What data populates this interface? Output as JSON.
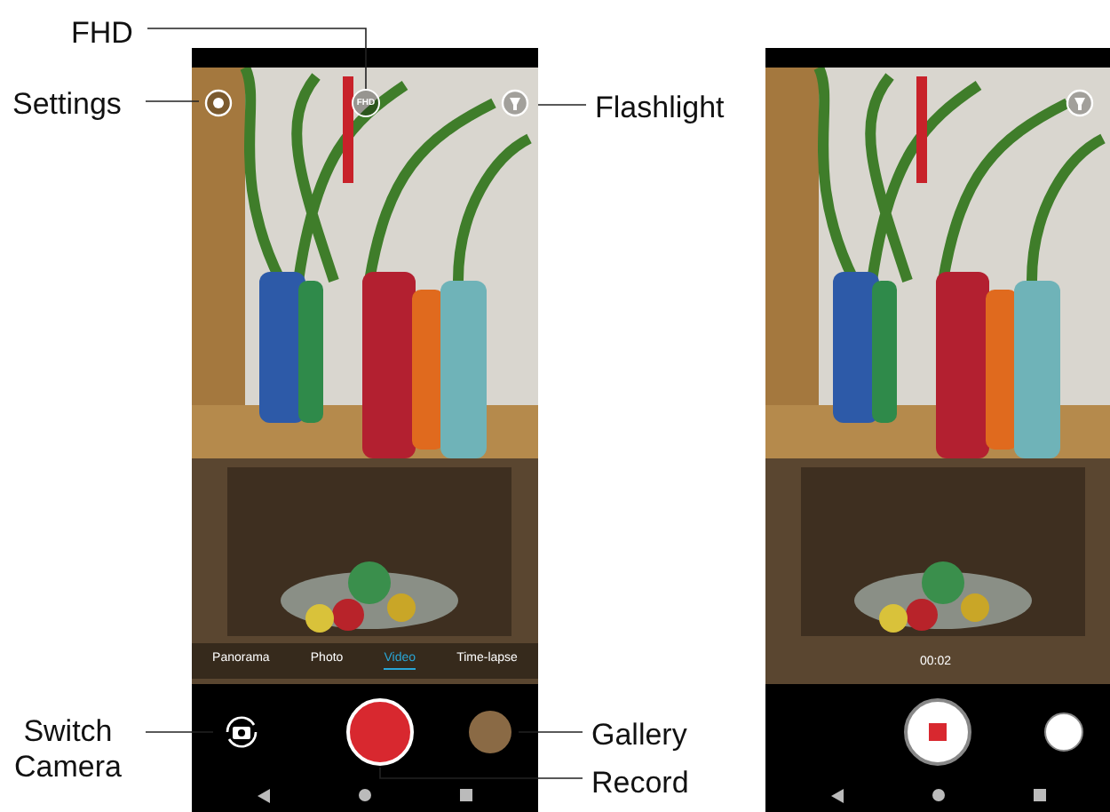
{
  "callouts": [
    "FHD",
    "Settings",
    "Flashlight",
    "Switch\nCamera",
    "Gallery",
    "Record"
  ],
  "screens": [
    {
      "kind": "idle",
      "quality": "FHD",
      "modes": [
        {
          "label": "Panorama",
          "selected": false
        },
        {
          "label": "Photo",
          "selected": false
        },
        {
          "label": "Video",
          "selected": true
        },
        {
          "label": "Time-lapse",
          "selected": false
        }
      ]
    },
    {
      "kind": "recording",
      "timer": "00:02"
    }
  ]
}
